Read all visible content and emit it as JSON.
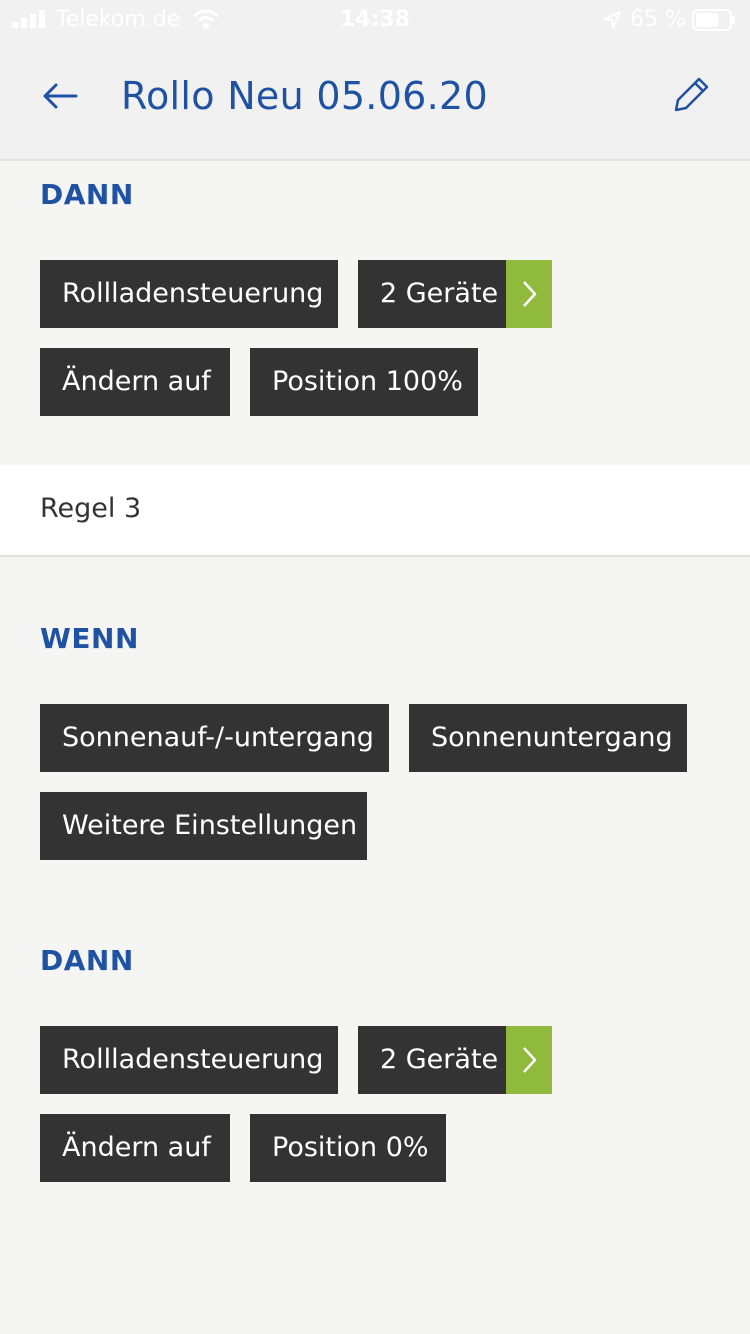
{
  "status_bar": {
    "carrier": "Telekom.de",
    "time": "14:38",
    "battery": "65 %"
  },
  "header": {
    "title": "Rollo Neu 05.06.20"
  },
  "rule_2": {
    "then_label": "DANN",
    "then_chips": {
      "device_type": "Rollladensteuerung",
      "devices": "2 Geräte",
      "action": "Ändern auf",
      "value": "Position 100%"
    }
  },
  "rule_3": {
    "title": "Regel 3",
    "when_label": "WENN",
    "when_chips": {
      "trigger": "Sonnenauf-/-untergang",
      "event": "Sonnenuntergang",
      "more": "Weitere Einstellungen"
    },
    "then_label": "DANN",
    "then_chips": {
      "device_type": "Rollladensteuerung",
      "devices": "2 Geräte",
      "action": "Ändern auf",
      "value": "Position 0%"
    }
  },
  "colors": {
    "accent_blue": "#1f52a3",
    "chip_dark": "#333333",
    "chip_green": "#8fba3c",
    "background": "#f5f5f3"
  }
}
